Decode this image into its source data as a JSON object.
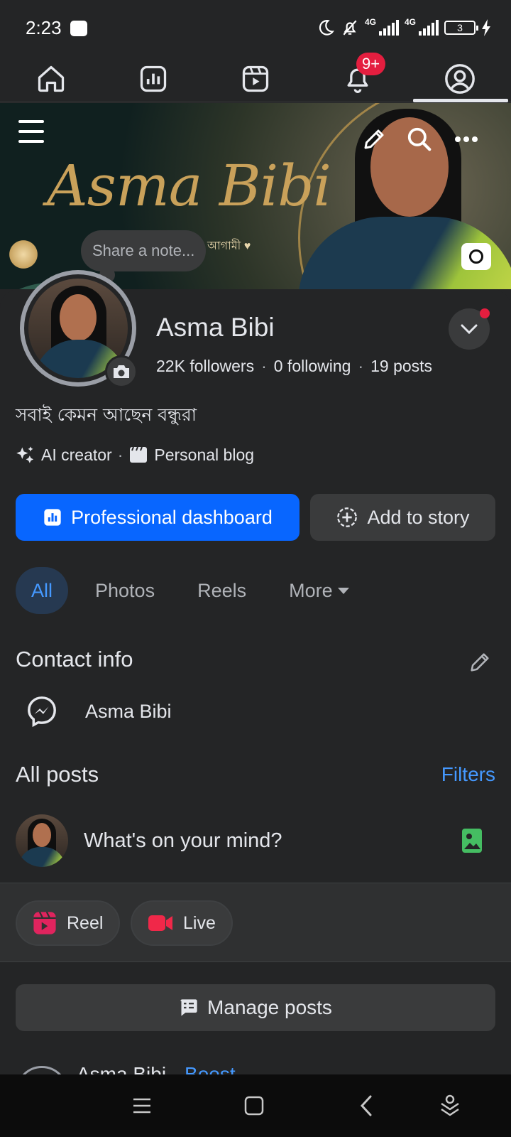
{
  "status_bar": {
    "time": "2:23",
    "network_1": "4G",
    "network_2": "4G",
    "battery": "3"
  },
  "tabs": {
    "notifications_badge": "9+",
    "icons": [
      "home-icon",
      "dashboard-icon",
      "video-icon",
      "bell-icon",
      "profile-icon"
    ],
    "active": "profile"
  },
  "cover": {
    "title": "Asma Bibi",
    "subtitle": "আগামী ♥"
  },
  "note": {
    "placeholder": "Share a note..."
  },
  "profile": {
    "name": "Asma Bibi",
    "followers": "22K followers",
    "following": "0 following",
    "posts": "19 posts",
    "separator": "·",
    "bio": "সবাই কেমন আছেন বন্ধুরা",
    "tag_1": "AI creator",
    "tag_2": "Personal blog"
  },
  "buttons": {
    "dashboard": "Professional dashboard",
    "story": "Add to story"
  },
  "filter_tabs": {
    "all": "All",
    "photos": "Photos",
    "reels": "Reels",
    "more": "More"
  },
  "contact": {
    "title": "Contact info",
    "messenger_name": "Asma Bibi"
  },
  "posts": {
    "title": "All posts",
    "filters": "Filters",
    "composer_placeholder": "What's on your mind?",
    "reel_label": "Reel",
    "live_label": "Live",
    "manage_label": "Manage posts",
    "peek_name": "Asma Bibi",
    "peek_boost": "Boost"
  },
  "colors": {
    "accent": "#0866ff",
    "link": "#4599ff",
    "badge": "#e41e3f",
    "background": "#242526",
    "reel": "#e0245e",
    "live": "#f02849",
    "photo": "#45bd62"
  }
}
